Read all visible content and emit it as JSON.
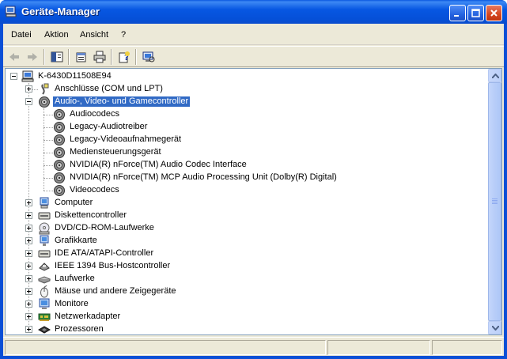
{
  "window": {
    "title": "Geräte-Manager"
  },
  "menu": {
    "items": [
      "Datei",
      "Aktion",
      "Ansicht",
      "?"
    ]
  },
  "toolbar": {
    "buttons": [
      "back-arrow-icon",
      "forward-arrow-icon",
      "show-hide-console-tree-icon",
      "properties-icon",
      "print-icon",
      "help-icon",
      "scan-hardware-icon"
    ]
  },
  "tree": {
    "root": "K-6430D11508E94",
    "categories": [
      {
        "label": "Anschlüsse (COM und LPT)",
        "icon": "port-icon",
        "expanded": false
      },
      {
        "label": "Audio-, Video- und Gamecontroller",
        "icon": "speaker-icon",
        "expanded": true,
        "selected": true,
        "children": [
          "Audiocodecs",
          "Legacy-Audiotreiber",
          "Legacy-Videoaufnahmegerät",
          "Mediensteuerungsgerät",
          "NVIDIA(R) nForce(TM) Audio Codec Interface",
          "NVIDIA(R) nForce(TM) MCP Audio Processing Unit (Dolby(R) Digital)",
          "Videocodecs"
        ]
      },
      {
        "label": "Computer",
        "icon": "computer-icon",
        "expanded": false
      },
      {
        "label": "Diskettencontroller",
        "icon": "floppy-controller-icon",
        "expanded": false
      },
      {
        "label": "DVD/CD-ROM-Laufwerke",
        "icon": "cdrom-icon",
        "expanded": false
      },
      {
        "label": "Grafikkarte",
        "icon": "display-adapter-icon",
        "expanded": false
      },
      {
        "label": "IDE ATA/ATAPI-Controller",
        "icon": "ide-controller-icon",
        "expanded": false
      },
      {
        "label": "IEEE 1394 Bus-Hostcontroller",
        "icon": "ieee1394-icon",
        "expanded": false
      },
      {
        "label": "Laufwerke",
        "icon": "disk-drive-icon",
        "expanded": false
      },
      {
        "label": "Mäuse und andere Zeigegeräte",
        "icon": "mouse-icon",
        "expanded": false
      },
      {
        "label": "Monitore",
        "icon": "monitor-icon",
        "expanded": false
      },
      {
        "label": "Netzwerkadapter",
        "icon": "network-adapter-icon",
        "expanded": false
      },
      {
        "label": "Prozessoren",
        "icon": "processor-icon",
        "expanded": false
      }
    ]
  },
  "colors": {
    "titlebar": "#0a58e0",
    "selection": "#316ac5",
    "chrome": "#ece9d8"
  }
}
